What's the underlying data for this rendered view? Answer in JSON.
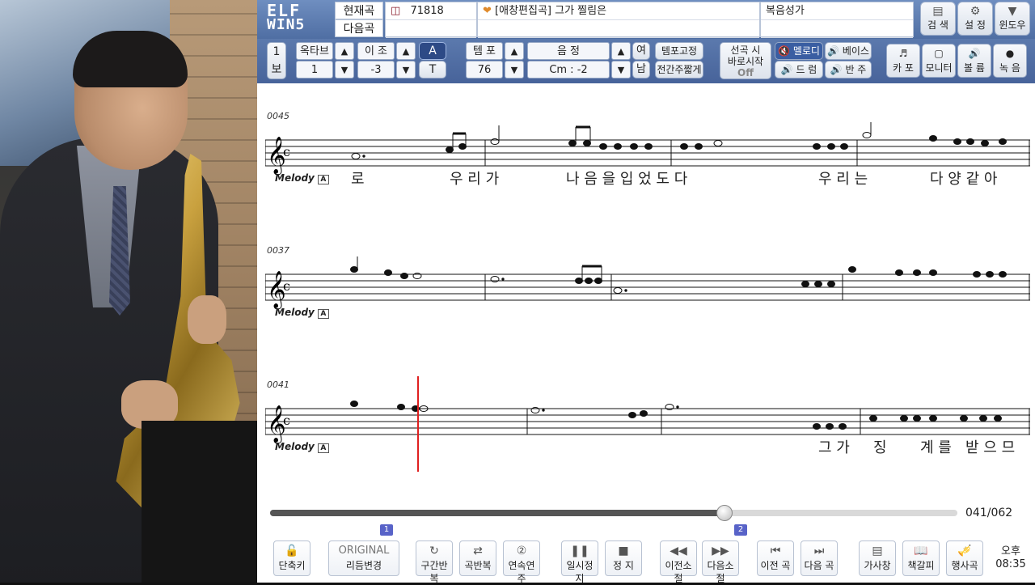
{
  "top": {
    "logo_line1": "ELF",
    "logo_line2": "WIN5",
    "current_label": "현재곡",
    "next_label": "다음곡",
    "song_number": "71818",
    "song_title": "[애창편집곡] 그가 찔림은",
    "song_category": "복음성가",
    "buttons": [
      {
        "label": "검 색",
        "icon": "search-icon"
      },
      {
        "label": "설 정",
        "icon": "gear-icon"
      },
      {
        "label": "윈도우",
        "icon": "chevron-down-icon"
      }
    ]
  },
  "controls": {
    "page_label": "1",
    "page_sub": "보",
    "octave_label": "옥타브",
    "octave_value": "1",
    "transpose_label": "이 조",
    "transpose_value": "-3",
    "mode_a": "A",
    "mode_t": "T",
    "tempo_label": "템 포",
    "tempo_value": "76",
    "key_label": "음 정",
    "key_value": "Cm : -2",
    "gender_f": "여",
    "gender_m": "남",
    "tempo_fix": "템포고정",
    "interlude_short": "전간주짧게",
    "direct_start_l1": "선곡 시",
    "direct_start_l2": "바로시작",
    "direct_start_state": "Off",
    "melody": "멜로디",
    "bass": "베이스",
    "drum": "드 럼",
    "accomp": "반 주",
    "capo": "카 포",
    "monitor": "모니터",
    "volume": "볼 륨",
    "record": "녹 음"
  },
  "score": {
    "systems": [
      {
        "measure": "0045",
        "label": "Melody",
        "lyrics": [
          "로",
          "우 리 가",
          "나 음 을 입 었 도 다",
          "우 리 는",
          "다 양 같 아"
        ]
      },
      {
        "measure": "0037",
        "label": "Melody",
        "lyrics": []
      },
      {
        "measure": "0041",
        "label": "Melody",
        "lyrics": [
          "그 가",
          "징",
          "계 를",
          "받 으 므"
        ]
      }
    ]
  },
  "progress": {
    "fraction": 0.661,
    "counter": "041/062",
    "marker1": "1",
    "marker2": "2"
  },
  "bottom": {
    "buttons": [
      {
        "label": "단축키",
        "icon": "lock-icon"
      },
      {
        "label": "리듬변경",
        "icon": "original-text"
      },
      {
        "label": "구간반복",
        "icon": "section-repeat-icon"
      },
      {
        "label": "곡반복",
        "icon": "repeat-icon"
      },
      {
        "label": "연속연주",
        "icon": "continuous-icon"
      },
      {
        "label": "일시정지",
        "icon": "pause-icon"
      },
      {
        "label": "정 지",
        "icon": "stop-icon"
      },
      {
        "label": "이전소절",
        "icon": "rewind-icon"
      },
      {
        "label": "다음소절",
        "icon": "fast-forward-icon"
      },
      {
        "label": "이전 곡",
        "icon": "prev-track-icon"
      },
      {
        "label": "다음 곡",
        "icon": "next-track-icon"
      },
      {
        "label": "가사창",
        "icon": "lyrics-icon"
      },
      {
        "label": "책갈피",
        "icon": "bookmark-icon"
      },
      {
        "label": "행사곡",
        "icon": "trumpet-icon"
      }
    ],
    "original_text": "ORIGINAL",
    "clock_ampm": "오후",
    "clock_time": "08:35"
  }
}
